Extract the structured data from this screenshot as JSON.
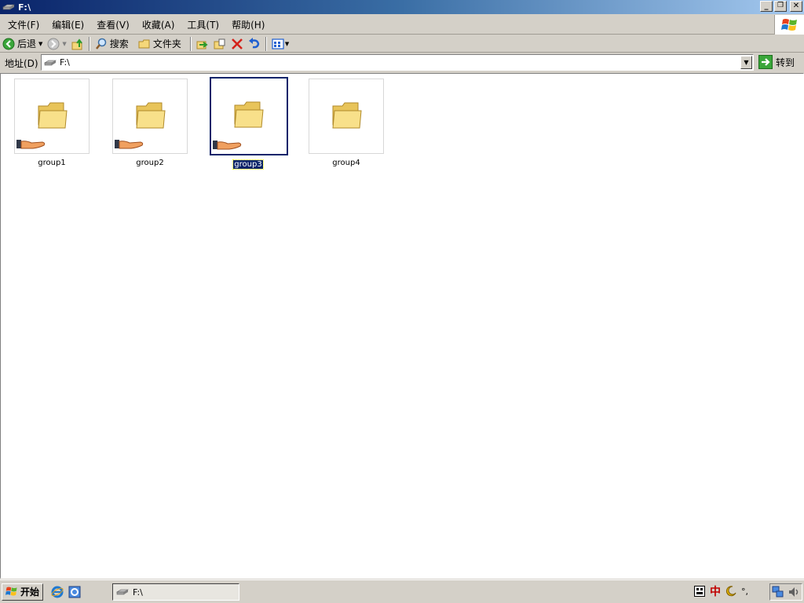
{
  "window": {
    "title": "F:\\",
    "minimize_label": "_",
    "maximize_label": "❐",
    "close_label": "✕"
  },
  "menubar": {
    "items": [
      "文件(F)",
      "编辑(E)",
      "查看(V)",
      "收藏(A)",
      "工具(T)",
      "帮助(H)"
    ]
  },
  "toolbar": {
    "back_label": "后退",
    "search_label": "搜索",
    "folders_label": "文件夹"
  },
  "address": {
    "label": "地址(D)",
    "value": "F:\\",
    "go_label": "转到"
  },
  "content": {
    "items": [
      {
        "label": "group1",
        "shared": true,
        "selected": false
      },
      {
        "label": "group2",
        "shared": true,
        "selected": false
      },
      {
        "label": "group3",
        "shared": true,
        "selected": true
      },
      {
        "label": "group4",
        "shared": false,
        "selected": false
      }
    ]
  },
  "taskbar": {
    "start_label": "开始",
    "task_label": "F:\\",
    "ime_label": "中",
    "tray_punct": "°,"
  },
  "colors": {
    "title_start": "#0a246a",
    "selection": "#0a246a",
    "folder": "#f5d77a"
  }
}
